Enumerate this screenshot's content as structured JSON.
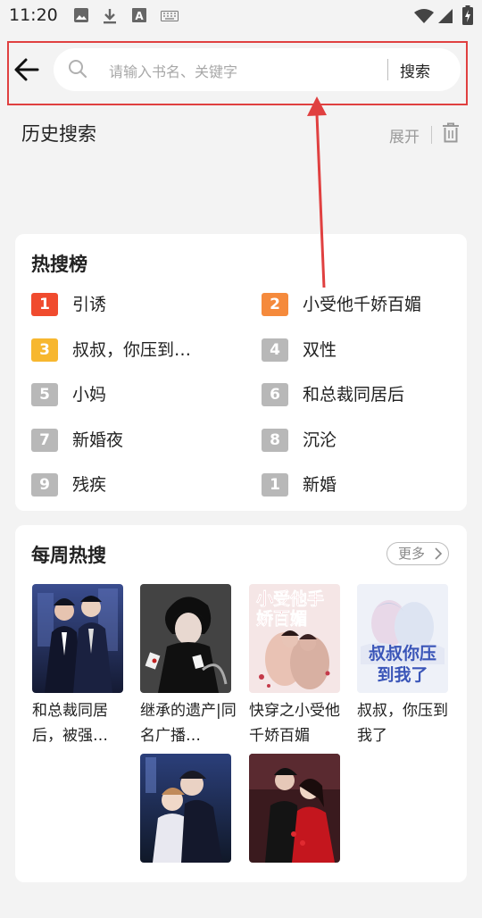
{
  "status_bar": {
    "time": "11:20",
    "icons": [
      "image-icon",
      "download-icon",
      "text-a-icon",
      "keyboard-icon",
      "wifi-icon",
      "signal-icon",
      "battery-charging-icon"
    ]
  },
  "search": {
    "placeholder": "请输入书名、关键字",
    "value": "",
    "button_label": "搜索"
  },
  "history": {
    "title": "历史搜索",
    "expand_label": "展开"
  },
  "hot": {
    "title": "热搜榜",
    "items": [
      {
        "rank": "1",
        "text": "引诱",
        "badge_color": "#f04b2e"
      },
      {
        "rank": "2",
        "text": "小受他千娇百媚",
        "badge_color": "#f58a3c"
      },
      {
        "rank": "3",
        "text": "叔叔，你压到…",
        "badge_color": "#f7b72f"
      },
      {
        "rank": "4",
        "text": "双性",
        "badge_color": "#b8b8b8"
      },
      {
        "rank": "5",
        "text": "小妈",
        "badge_color": "#b8b8b8"
      },
      {
        "rank": "6",
        "text": "和总裁同居后",
        "badge_color": "#b8b8b8"
      },
      {
        "rank": "7",
        "text": "新婚夜",
        "badge_color": "#b8b8b8"
      },
      {
        "rank": "8",
        "text": "沉沦",
        "badge_color": "#b8b8b8"
      },
      {
        "rank": "9",
        "text": "残疾",
        "badge_color": "#b8b8b8"
      },
      {
        "rank": "1",
        "text": "新婚",
        "badge_color": "#b8b8b8"
      }
    ]
  },
  "weekly": {
    "title": "每周热搜",
    "more_label": "更多",
    "books": [
      {
        "title": "和总裁同居后，被强…"
      },
      {
        "title": "继承的遗产|同名广播…"
      },
      {
        "title": "快穿之小受他千娇百媚"
      },
      {
        "title": "叔叔，你压到我了"
      },
      {
        "title": ""
      },
      {
        "title": ""
      }
    ],
    "cover_text": {
      "book3": "小受他手娇百媚",
      "book4": "叔叔你压到我了"
    }
  },
  "colors": {
    "annotation_red": "#e04040",
    "background": "#f3f3f3"
  }
}
